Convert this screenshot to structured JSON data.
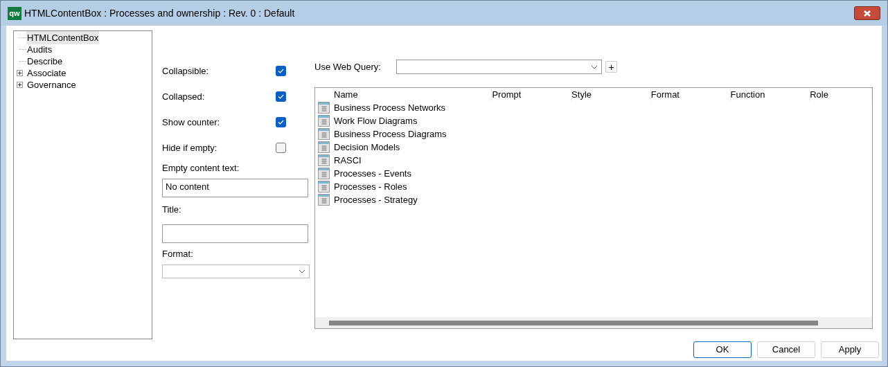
{
  "window": {
    "logo_text": "qw",
    "title": "HTMLContentBox : Processes and ownership : Rev. 0  : Default"
  },
  "tree": {
    "items": [
      {
        "label": "HTMLContentBox",
        "kind": "leaf",
        "selected": true
      },
      {
        "label": "Audits",
        "kind": "leaf",
        "selected": false
      },
      {
        "label": "Describe",
        "kind": "leaf",
        "selected": false
      },
      {
        "label": "Associate",
        "kind": "group",
        "selected": false
      },
      {
        "label": "Governance",
        "kind": "group",
        "selected": false
      }
    ]
  },
  "options": [
    {
      "label": "Collapsible:",
      "checked": true
    },
    {
      "label": "Collapsed:",
      "checked": true
    },
    {
      "label": "Show counter:",
      "checked": true
    },
    {
      "label": "Hide if empty:",
      "checked": false
    }
  ],
  "empty_content_text": {
    "label": "Empty content text:",
    "value": "No content"
  },
  "title_field": {
    "label": "Title:"
  },
  "format_field": {
    "label": "Format:"
  },
  "web_query": {
    "label": "Use Web Query:",
    "add_button": "+"
  },
  "table": {
    "columns": [
      "Name",
      "Prompt",
      "Style",
      "Format",
      "Function",
      "Role"
    ],
    "rows": [
      "Business Process Networks",
      "Work Flow Diagrams",
      "Business Process Diagrams",
      "Decision Models",
      "RASCI",
      "Processes - Events",
      "Processes - Roles",
      "Processes - Strategy"
    ]
  },
  "buttons": [
    {
      "label": "OK",
      "default": true
    },
    {
      "label": "Cancel",
      "default": false
    },
    {
      "label": "Apply",
      "default": false
    }
  ]
}
